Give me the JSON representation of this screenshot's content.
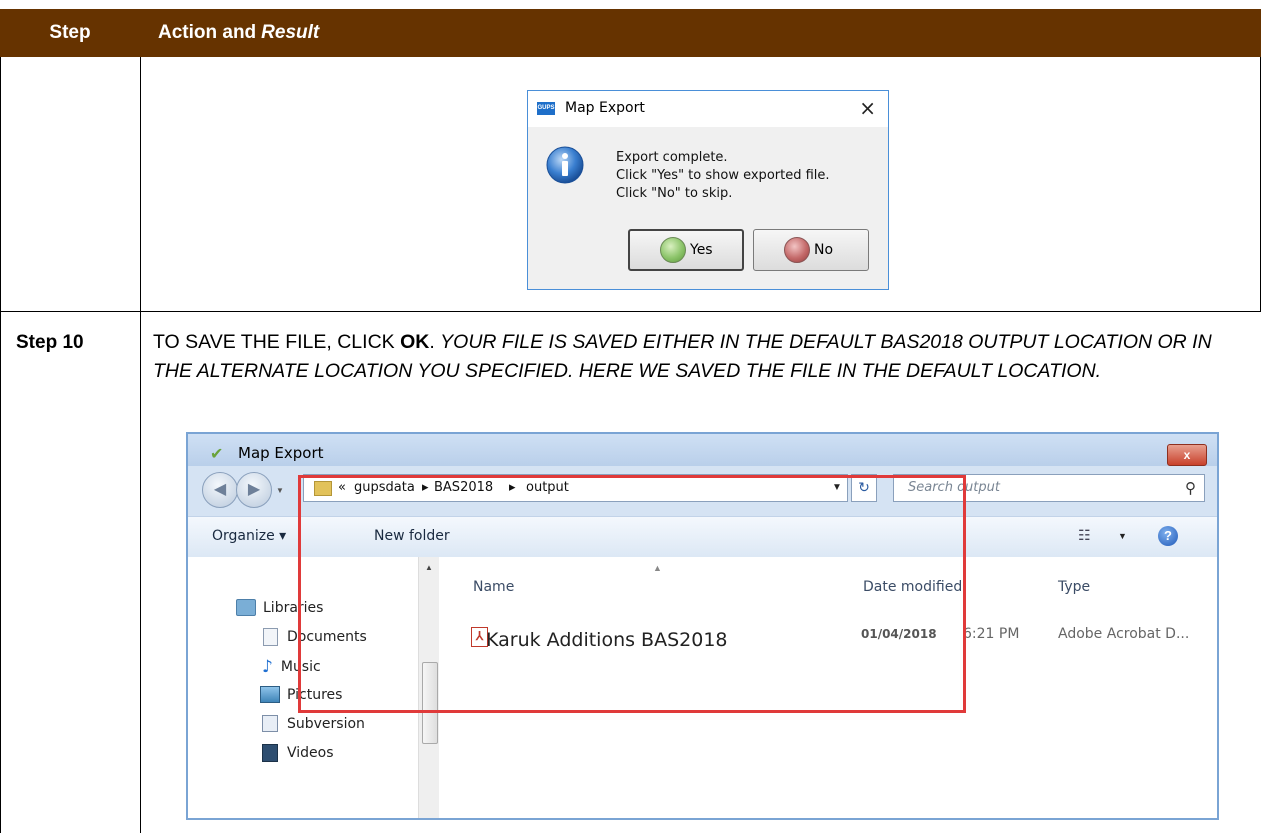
{
  "table": {
    "header_step": "Step",
    "header_action": "Action and",
    "header_result": "Result",
    "header_bg": "#663300"
  },
  "dialog1": {
    "app_icon_text": "GUPS",
    "title": "Map Export",
    "close_glyph": "×",
    "msg_line1": "Export complete.",
    "msg_line2": "Click \"Yes\" to show exported file.",
    "msg_line3": "Click \"No\" to skip.",
    "yes_label": "Yes",
    "no_label": "No",
    "icon": "info-icon"
  },
  "step10": {
    "label": "Step 10",
    "text_plain": "TO SAVE THE FILE, CLICK ",
    "text_bold": "OK",
    "text_dot": ". ",
    "text_italic": "YOUR FILE IS SAVED EITHER IN THE DEFAULT BAS2018 OUTPUT LOCATION OR IN THE ALTERNATE LOCATION YOU SPECIFIED. HERE WE SAVED THE FILE IN THE DEFAULT LOCATION."
  },
  "explorer": {
    "title": "Map Export",
    "close_glyph": "x",
    "address": {
      "prefix": "«",
      "crumb1": "gupsdata",
      "crumb2": "BAS2018",
      "crumb3": "output"
    },
    "search_placeholder": "Search output",
    "toolbar": {
      "organize": "Organize ▾",
      "new_folder": "New folder",
      "help": "?"
    },
    "nav_items": [
      "Libraries",
      "Documents",
      "Music",
      "Pictures",
      "Subversion",
      "Videos"
    ],
    "columns": {
      "name": "Name",
      "date": "Date modified",
      "type": "Type"
    },
    "file": {
      "name": "Karuk Additions BAS2018",
      "date": "01/04/2018",
      "time": "6:21 PM",
      "type": "Adobe Acrobat D..."
    },
    "highlight_color": "#e03a3a"
  }
}
